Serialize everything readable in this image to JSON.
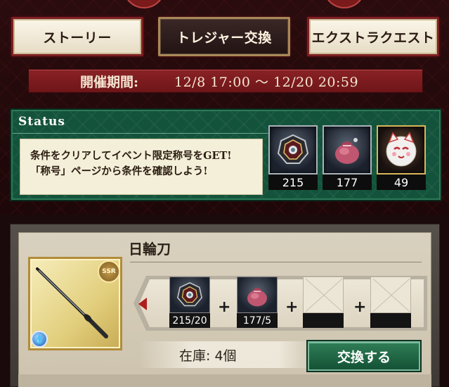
{
  "tabs": [
    {
      "label": "ストーリー",
      "active": false
    },
    {
      "label": "トレジャー交換",
      "active": true
    },
    {
      "label": "エクストラクエスト",
      "active": false
    }
  ],
  "period": {
    "label": "開催期間:",
    "value": "12/8 17:00 〜 12/20 20:59"
  },
  "status": {
    "title": "Status",
    "message_line1": "条件をクリアしてイベント限定称号をGET!",
    "message_line2": "「称号」ページから条件を確認しよう!",
    "items": [
      {
        "icon": "dark-crest-icon",
        "count": "215"
      },
      {
        "icon": "pink-pouch-icon",
        "count": "177"
      },
      {
        "icon": "cat-mask-icon",
        "count": "49"
      }
    ]
  },
  "reward": {
    "name": "日輪刀",
    "rarity": "SSR",
    "element": "water-icon",
    "requirements": [
      {
        "icon": "dark-crest-icon",
        "count": "215/20"
      },
      {
        "icon": "pink-pouch-icon",
        "count": "177/5"
      },
      {
        "icon": "empty-slot",
        "count": ""
      },
      {
        "icon": "empty-slot",
        "count": ""
      }
    ],
    "plus": "+",
    "stock": "在庫: 4個",
    "exchange_label": "交換する"
  },
  "colors": {
    "status_green": "#14533b",
    "period_red": "#8a2226",
    "button_green": "#2f7d57"
  }
}
